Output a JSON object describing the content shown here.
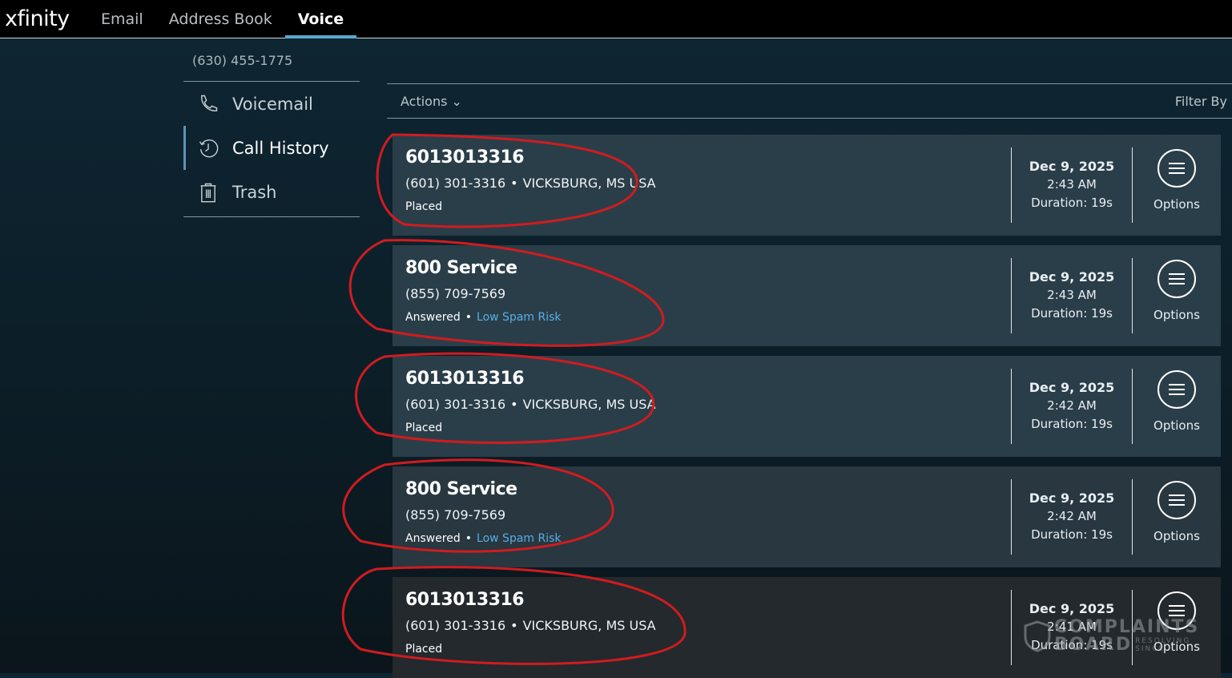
{
  "header": {
    "logo": "xfinity",
    "tabs": [
      {
        "label": "Email"
      },
      {
        "label": "Address Book"
      },
      {
        "label": "Voice"
      }
    ]
  },
  "sidebar": {
    "account": "(630) 455-1775",
    "items": [
      {
        "label": "Voicemail",
        "icon": "phone-icon"
      },
      {
        "label": "Call History",
        "icon": "history-icon"
      },
      {
        "label": "Trash",
        "icon": "trash-icon"
      }
    ]
  },
  "toolbar": {
    "actions": "Actions",
    "filter": "Filter By"
  },
  "calls": [
    {
      "name": "6013013316",
      "number": "(601) 301-3316",
      "location": "VICKSBURG, MS USA",
      "status": "Placed",
      "spam": "",
      "date": "Dec 9, 2025",
      "time": "2:43 AM",
      "duration": "Duration: 19s",
      "options": "Options"
    },
    {
      "name": "800 Service",
      "number": "(855) 709-7569",
      "location": "",
      "status": "Answered",
      "spam": "Low Spam Risk",
      "date": "Dec 9, 2025",
      "time": "2:43 AM",
      "duration": "Duration: 19s",
      "options": "Options"
    },
    {
      "name": "6013013316",
      "number": "(601) 301-3316",
      "location": "VICKSBURG, MS USA",
      "status": "Placed",
      "spam": "",
      "date": "Dec 9, 2025",
      "time": "2:42 AM",
      "duration": "Duration: 19s",
      "options": "Options"
    },
    {
      "name": "800 Service",
      "number": "(855) 709-7569",
      "location": "",
      "status": "Answered",
      "spam": "Low Spam Risk",
      "date": "Dec 9, 2025",
      "time": "2:42 AM",
      "duration": "Duration: 19s",
      "options": "Options"
    },
    {
      "name": "6013013316",
      "number": "(601) 301-3316",
      "location": "VICKSBURG, MS USA",
      "status": "Placed",
      "spam": "",
      "date": "Dec 9, 2025",
      "time": "2:41 AM",
      "duration": "Duration: 19s",
      "options": "Options"
    }
  ],
  "watermark": {
    "line1": "COMPLAINTS",
    "line2": "BOARD",
    "tag1": "RESOLVING",
    "tag2": "SINCE"
  },
  "colors": {
    "accent": "#5ba7c8",
    "spam": "#5aaee6",
    "annotation": "#d01c1f"
  }
}
